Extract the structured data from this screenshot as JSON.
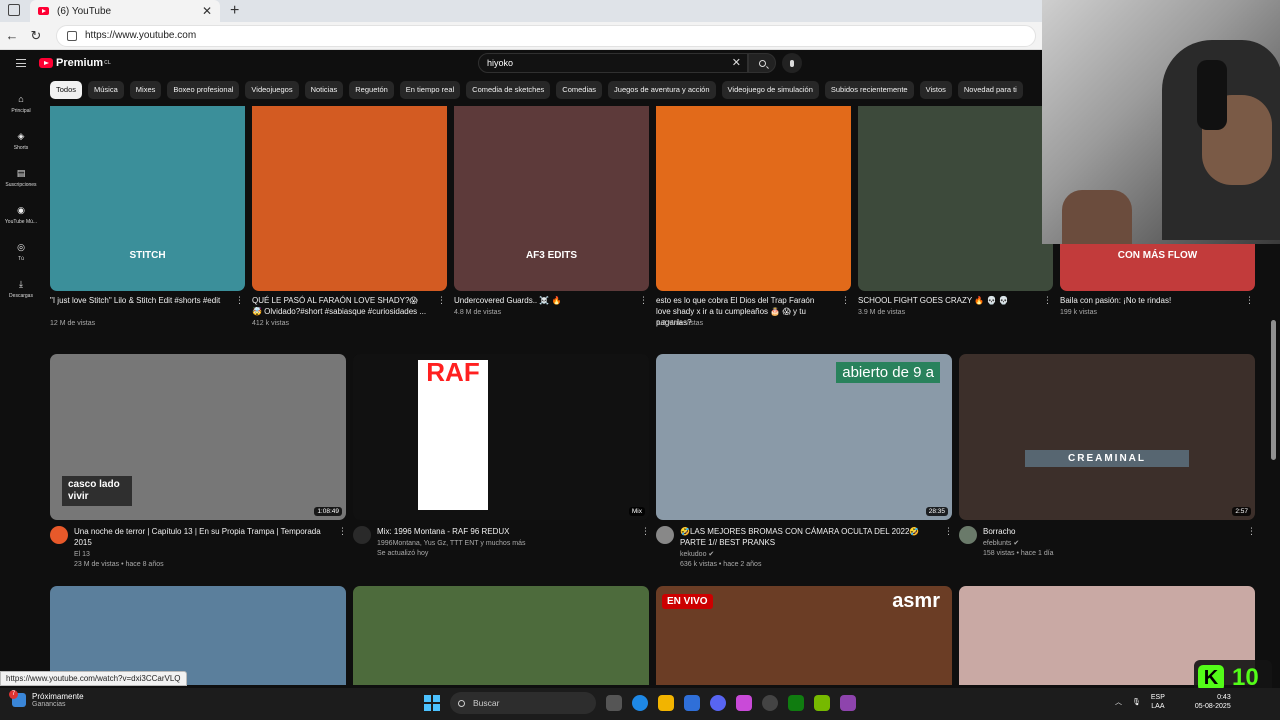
{
  "browser": {
    "tab_title": "(6) YouTube",
    "tab_close": "✕",
    "newtab": "+",
    "url": "https://www.youtube.com",
    "status_url": "https://www.youtube.com/watch?v=dxi3CCarVLQ"
  },
  "youtube": {
    "logo_text": "Premium",
    "logo_region": "CL",
    "search_value": "hiyoko",
    "chips": [
      "Todos",
      "Música",
      "Mixes",
      "Boxeo profesional",
      "Videojuegos",
      "Noticias",
      "Reguetón",
      "En tiempo real",
      "Comedia de sketches",
      "Comedias",
      "Juegos de aventura y acción",
      "Videojuego de simulación",
      "Subidos recientemente",
      "Vistos",
      "Novedad para ti"
    ],
    "sidebar": [
      {
        "label": "Principal",
        "icon": "home-icon"
      },
      {
        "label": "Shorts",
        "icon": "shorts-icon"
      },
      {
        "label": "Suscripciones",
        "icon": "subscriptions-icon"
      },
      {
        "label": "YouTube Mú...",
        "icon": "youtube-music-icon"
      },
      {
        "label": "Tú",
        "icon": "you-icon"
      },
      {
        "label": "Descargas",
        "icon": "downloads-icon"
      }
    ],
    "row1": [
      {
        "title": "\"I just love Stitch\" Lilo & Stitch Edit #shorts #edit",
        "meta": "12 M de vistas",
        "overlay": "STITCH",
        "color": "#3b8f9a"
      },
      {
        "title": "QUÉ LE PASÓ AL FARAÓN LOVE SHADY?😱🤯 Olvidado?#short #sabiasque #curiosidades ...",
        "meta": "412 k vistas",
        "color": "#d35b22"
      },
      {
        "title": "Undercovered Guards.. ☠️ 🔥",
        "meta": "4.8 M de vistas",
        "overlay": "AF3 EDITS",
        "color": "#5d3a3a"
      },
      {
        "title": "esto es lo que cobra  El Dios del Trap Faraón love shady x ir a tu cumpleaños 🎂 😱 y tu pagarías?",
        "meta": "1.2 M de vistas",
        "color": "#e26a1a"
      },
      {
        "title": "SCHOOL FIGHT GOES CRAZY 🔥 💀 💀",
        "meta": "3.9 M de vistas",
        "color": "#3d4a3b"
      },
      {
        "title": "Baila con pasión: ¡No te rindas!",
        "meta": "199 k vistas",
        "overlay": "CON MÁS FLOW",
        "color": "#c23b3b"
      }
    ],
    "row2": [
      {
        "title": "Una noche de terror | Capítulo 13 | En su Propia Trampa | Temporada 2015",
        "channel": "El 13",
        "meta": "23 M de vistas • hace 8 años",
        "duration": "1:08:49",
        "overlay": "casco lado vivir",
        "color": "#777"
      },
      {
        "title": "Mix: 1996 Montana - RAF 96 REDUX",
        "channel": "1996Montana, Yus Gz, TTT ENT y muchos más",
        "meta": "Se actualizó hoy",
        "duration": "Mix",
        "overlay": "RAF",
        "color": "#111"
      },
      {
        "title": "🤣LAS MEJORES BROMAS CON CÁMARA OCULTA DEL 2022🤣 PARTE 1// BEST PRANKS",
        "channel": "kekudoo ✔",
        "meta": "636 k vistas • hace 2 años",
        "duration": "28:35",
        "overlay": "abierto de 9 a",
        "color": "#8a9aa8"
      },
      {
        "title": "Borracho",
        "channel": "efeblunts ✔",
        "meta": "158 vistas • hace 1 día",
        "duration": "2:57",
        "overlay": "CREAMINAL",
        "color": "#3c2f2a"
      }
    ],
    "row3": [
      {
        "color": "#5b7f9c"
      },
      {
        "color": "#4d6b3c"
      },
      {
        "overlay": "EN VIVO",
        "overlay2": "asmr",
        "color": "#6b3d25"
      },
      {
        "color": "#c9a9a4"
      }
    ]
  },
  "taskbar": {
    "weather_badge": "7",
    "weather_title": "Próximamente",
    "weather_sub": "Ganancias",
    "search_placeholder": "Buscar",
    "lang_1": "ESP",
    "lang_2": "LAA",
    "time": "0:43",
    "date": "05-08-2025"
  },
  "kick_badge": {
    "letter": "K",
    "count": "10"
  }
}
